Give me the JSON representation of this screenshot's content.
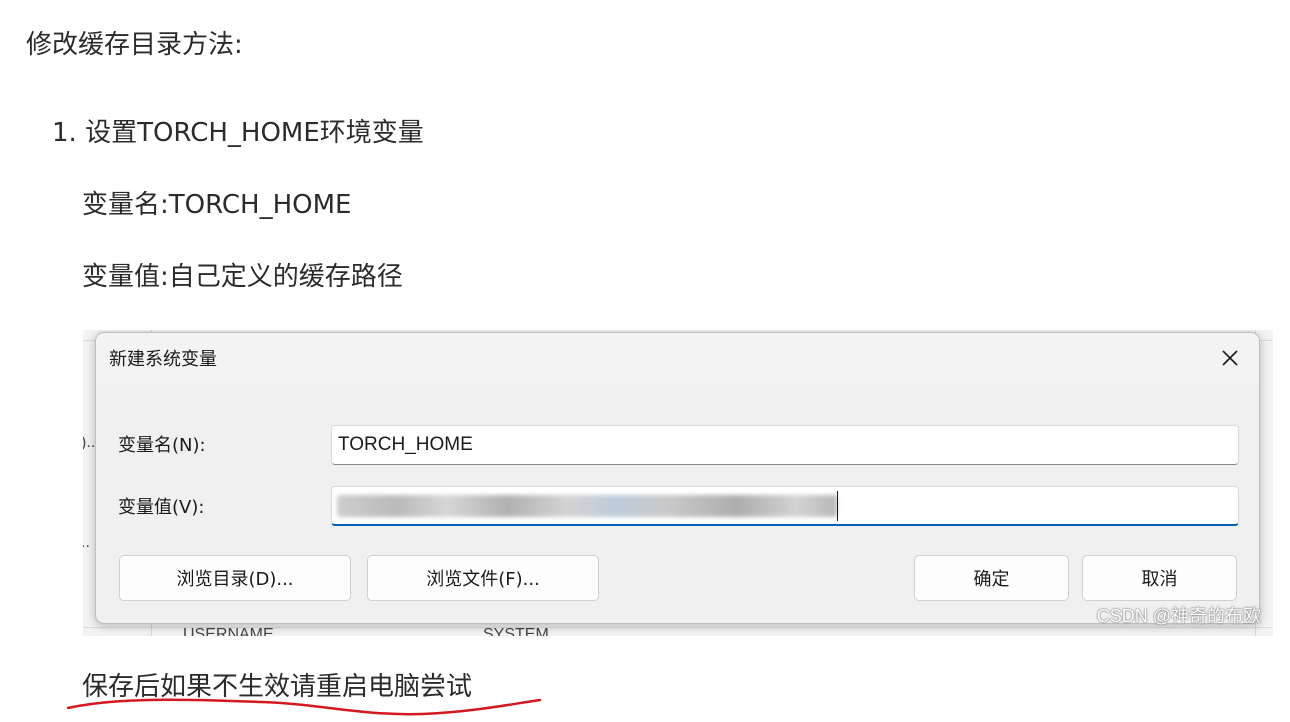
{
  "article": {
    "intro": "修改缓存目录方法:",
    "step1": "1. 设置TORCH_HOME环境变量",
    "var_name_line": "变量名:TORCH_HOME",
    "var_value_line": "变量值:自己定义的缓存路径",
    "note": "保存后如果不生效请重启电脑尝试"
  },
  "background": {
    "frag_left_top": ")..",
    "frag_left_bottom": "..",
    "frag_bottom_left": "USERNAME",
    "frag_bottom_right": "SYSTEM"
  },
  "dialog": {
    "title": "新建系统变量",
    "close_icon": "close-icon",
    "name_label": "变量名(N):",
    "name_value": "TORCH_HOME",
    "value_label": "变量值(V):",
    "value_value": "",
    "buttons": {
      "browse_dir": "浏览目录(D)...",
      "browse_file": "浏览文件(F)...",
      "ok": "确定",
      "cancel": "取消"
    }
  },
  "watermark": "CSDN @神奇的布欧",
  "colors": {
    "accent_blue": "#005fb8",
    "scribble_red": "#d4181f",
    "text": "#2b2b2b"
  }
}
